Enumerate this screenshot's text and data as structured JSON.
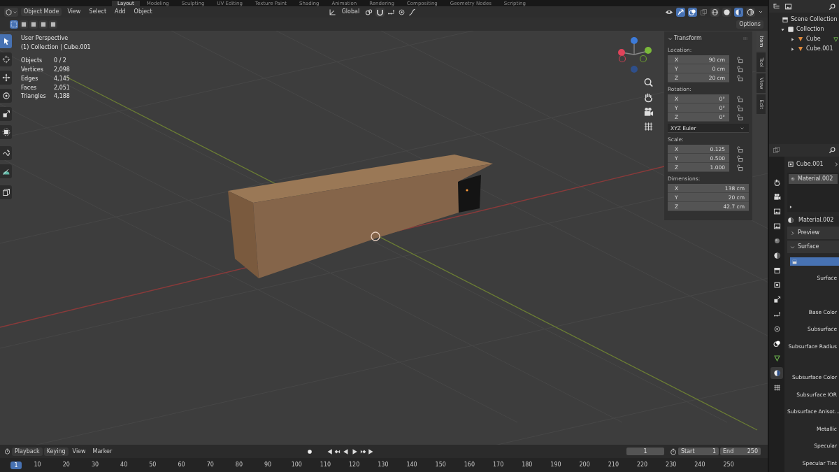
{
  "workspace_tabs": [
    {
      "label": "Layout",
      "selected": true
    },
    {
      "label": "Modeling",
      "selected": false
    },
    {
      "label": "Sculpting",
      "selected": false
    },
    {
      "label": "UV Editing",
      "selected": false
    },
    {
      "label": "Texture Paint",
      "selected": false
    },
    {
      "label": "Shading",
      "selected": false
    },
    {
      "label": "Animation",
      "selected": false
    },
    {
      "label": "Rendering",
      "selected": false
    },
    {
      "label": "Compositing",
      "selected": false
    },
    {
      "label": "Geometry Nodes",
      "selected": false
    },
    {
      "label": "Scripting",
      "selected": false
    }
  ],
  "header": {
    "mode": "Object Mode",
    "menus": [
      "View",
      "Select",
      "Add",
      "Object"
    ],
    "orientation": "Global",
    "options": "Options"
  },
  "select_modes": [
    {
      "selected": true
    },
    {
      "selected": false
    },
    {
      "selected": false
    },
    {
      "selected": false
    },
    {
      "selected": false
    }
  ],
  "shading_modes": [
    {
      "selected": false
    },
    {
      "selected": false
    },
    {
      "selected": true
    },
    {
      "selected": false
    }
  ],
  "toolbar": [
    {
      "selected": true
    },
    {
      "selected": false
    },
    {
      "selected": false
    },
    {
      "selected": false
    },
    {
      "selected": false
    },
    {
      "selected": false
    },
    {
      "selected": false
    },
    {
      "selected": false
    },
    {
      "selected": false
    }
  ],
  "viewport": {
    "view_name": "User Perspective",
    "context": "(1) Collection | Cube.001",
    "stats": [
      {
        "label": "Objects",
        "value": "0 / 2"
      },
      {
        "label": "Vertices",
        "value": "2,098"
      },
      {
        "label": "Edges",
        "value": "4,145"
      },
      {
        "label": "Faces",
        "value": "2,051"
      },
      {
        "label": "Triangles",
        "value": "4,188"
      }
    ]
  },
  "sidebar": {
    "tabs": [
      {
        "label": "Item",
        "selected": true
      },
      {
        "label": "Tool",
        "selected": false
      },
      {
        "label": "View",
        "selected": false
      },
      {
        "label": "Edit",
        "selected": false
      }
    ],
    "panel": "Transform",
    "rotation_mode": "XYZ Euler",
    "groups": [
      {
        "label": "Location:",
        "fields": [
          {
            "axis": "X",
            "value": "90 cm",
            "locked": false
          },
          {
            "axis": "Y",
            "value": "0 cm",
            "locked": false
          },
          {
            "axis": "Z",
            "value": "20 cm",
            "locked": false
          }
        ]
      },
      {
        "label": "Rotation:",
        "fields": [
          {
            "axis": "X",
            "value": "0°",
            "locked": false
          },
          {
            "axis": "Y",
            "value": "0°",
            "locked": false
          },
          {
            "axis": "Z",
            "value": "0°",
            "locked": false
          }
        ]
      },
      {
        "label": "Scale:",
        "fields": [
          {
            "axis": "X",
            "value": "0.125",
            "locked": false
          },
          {
            "axis": "Y",
            "value": "0.500",
            "locked": false
          },
          {
            "axis": "Z",
            "value": "1.000",
            "locked": false
          }
        ]
      },
      {
        "label": "Dimensions:",
        "fields": [
          {
            "axis": "X",
            "value": "138 cm"
          },
          {
            "axis": "Y",
            "value": "20 cm"
          },
          {
            "axis": "Z",
            "value": "42.7 cm"
          }
        ]
      }
    ]
  },
  "outliner": {
    "root": "Scene Collection",
    "items": [
      {
        "label": "Collection",
        "expanded": true,
        "children": [
          {
            "label": "Cube",
            "expanded": false
          },
          {
            "label": "Cube.001",
            "expanded": false
          }
        ]
      }
    ]
  },
  "properties": {
    "tabs": [
      {
        "selected": false
      },
      {
        "selected": false
      },
      {
        "selected": false
      },
      {
        "selected": false
      },
      {
        "selected": false
      },
      {
        "selected": false
      },
      {
        "selected": false
      },
      {
        "selected": false
      },
      {
        "selected": false
      },
      {
        "selected": false
      },
      {
        "selected": false
      },
      {
        "selected": false
      },
      {
        "selected": false
      },
      {
        "selected": true
      },
      {
        "selected": false
      }
    ],
    "object": "Cube.001",
    "slots": [
      {
        "label": "Material.002",
        "selected": true
      }
    ],
    "material": "Material.002",
    "panels": [
      {
        "label": "Preview",
        "expanded": false
      },
      {
        "label": "Surface",
        "expanded": true
      }
    ],
    "inputs": [
      "Surface",
      "Base Color",
      "Subsurface",
      "Subsurface Radius",
      "Subsurface Color",
      "Subsurface IOR",
      "Subsurface Anisot...",
      "Metallic",
      "Specular",
      "Specular Tint"
    ]
  },
  "timeline": {
    "menus": [
      "Playback",
      "Keying",
      "View",
      "Marker"
    ],
    "current_frame": "1",
    "start_label": "Start",
    "start": "1",
    "end_label": "End",
    "end": "250",
    "playhead": "1",
    "ruler": [
      "10",
      "20",
      "30",
      "40",
      "50",
      "60",
      "70",
      "80",
      "90",
      "100",
      "110",
      "120",
      "130",
      "140",
      "150",
      "160",
      "170",
      "180",
      "190",
      "200",
      "210",
      "220",
      "230",
      "240",
      "250"
    ]
  }
}
